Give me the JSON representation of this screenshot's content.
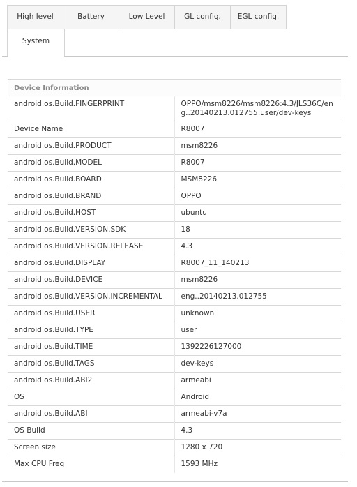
{
  "tabs": {
    "row1": [
      {
        "label": "High level"
      },
      {
        "label": "Battery"
      },
      {
        "label": "Low Level"
      },
      {
        "label": "GL config."
      },
      {
        "label": "EGL config."
      }
    ],
    "active": {
      "label": "System"
    }
  },
  "table": {
    "section_title": "Device Information",
    "rows": [
      {
        "key": "android.os.Build.FINGERPRINT",
        "value": "OPPO/msm8226/msm8226:4.3/JLS36C/eng..20140213.012755:user/dev-keys"
      },
      {
        "key": "Device Name",
        "value": "R8007"
      },
      {
        "key": "android.os.Build.PRODUCT",
        "value": "msm8226"
      },
      {
        "key": "android.os.Build.MODEL",
        "value": "R8007"
      },
      {
        "key": "android.os.Build.BOARD",
        "value": "MSM8226"
      },
      {
        "key": "android.os.Build.BRAND",
        "value": "OPPO"
      },
      {
        "key": "android.os.Build.HOST",
        "value": "ubuntu"
      },
      {
        "key": "android.os.Build.VERSION.SDK",
        "value": "18"
      },
      {
        "key": "android.os.Build.VERSION.RELEASE",
        "value": "4.3"
      },
      {
        "key": "android.os.Build.DISPLAY",
        "value": "R8007_11_140213"
      },
      {
        "key": "android.os.Build.DEVICE",
        "value": "msm8226"
      },
      {
        "key": "android.os.Build.VERSION.INCREMENTAL",
        "value": "eng..20140213.012755"
      },
      {
        "key": "android.os.Build.USER",
        "value": "unknown"
      },
      {
        "key": "android.os.Build.TYPE",
        "value": "user"
      },
      {
        "key": "android.os.Build.TIME",
        "value": "1392226127000"
      },
      {
        "key": "android.os.Build.TAGS",
        "value": "dev-keys"
      },
      {
        "key": "android.os.Build.ABI2",
        "value": "armeabi"
      },
      {
        "key": "OS",
        "value": "Android"
      },
      {
        "key": "android.os.Build.ABI",
        "value": "armeabi-v7a"
      },
      {
        "key": "OS Build",
        "value": "4.3"
      },
      {
        "key": "Screen size",
        "value": "1280 x 720"
      },
      {
        "key": "Max CPU Freq",
        "value": "1593 MHz"
      }
    ]
  }
}
